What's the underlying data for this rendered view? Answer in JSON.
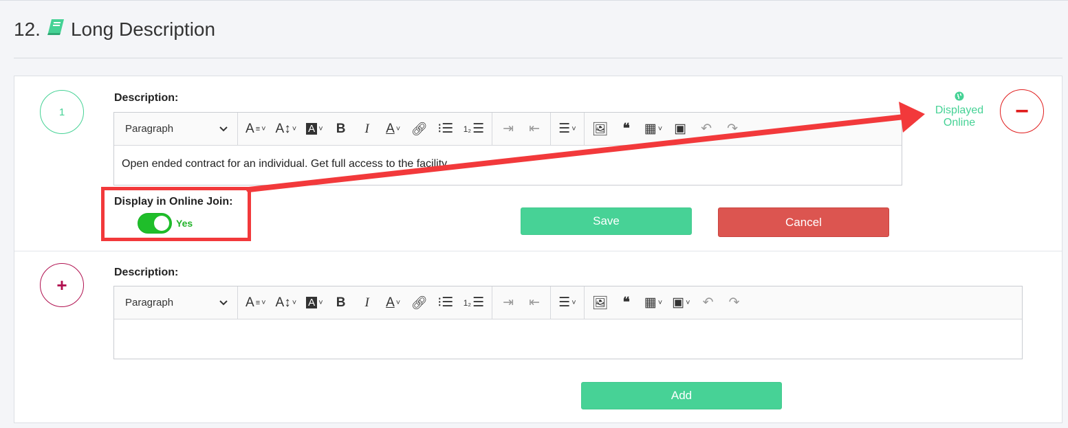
{
  "section": {
    "number": "12.",
    "icon": "book-icon",
    "title": "Long Description"
  },
  "colors": {
    "green": "#45d295",
    "red": "#dc5550",
    "annotation_red": "#f2393b",
    "toggle_green": "#1fbe2a",
    "plus_color": "#b0104f"
  },
  "item1": {
    "number": "1",
    "description_label": "Description:",
    "paragraph_select": "Paragraph",
    "content": "Open ended contract for an individual. Get full access to the facility.",
    "online_join_label": "Display in Online Join:",
    "toggle_value": "Yes",
    "save_label": "Save",
    "cancel_label": "Cancel",
    "status_line1": "Displayed",
    "status_line2": "Online",
    "status_icon": "globe-icon",
    "remove_symbol": "−"
  },
  "item2": {
    "add_symbol": "+",
    "description_label": "Description:",
    "paragraph_select": "Paragraph",
    "content": "",
    "add_label": "Add"
  },
  "toolbar": {
    "chevron": "⌄",
    "icons": [
      "font-size-icon",
      "font-family-icon",
      "font-background-icon",
      "bold-icon",
      "italic-icon",
      "font-color-icon",
      "link-icon",
      "bulleted-list-icon",
      "numbered-list-icon",
      "indent-icon",
      "outdent-icon",
      "align-icon",
      "image-icon",
      "blockquote-icon",
      "table-icon",
      "media-icon",
      "undo-icon",
      "redo-icon"
    ]
  }
}
